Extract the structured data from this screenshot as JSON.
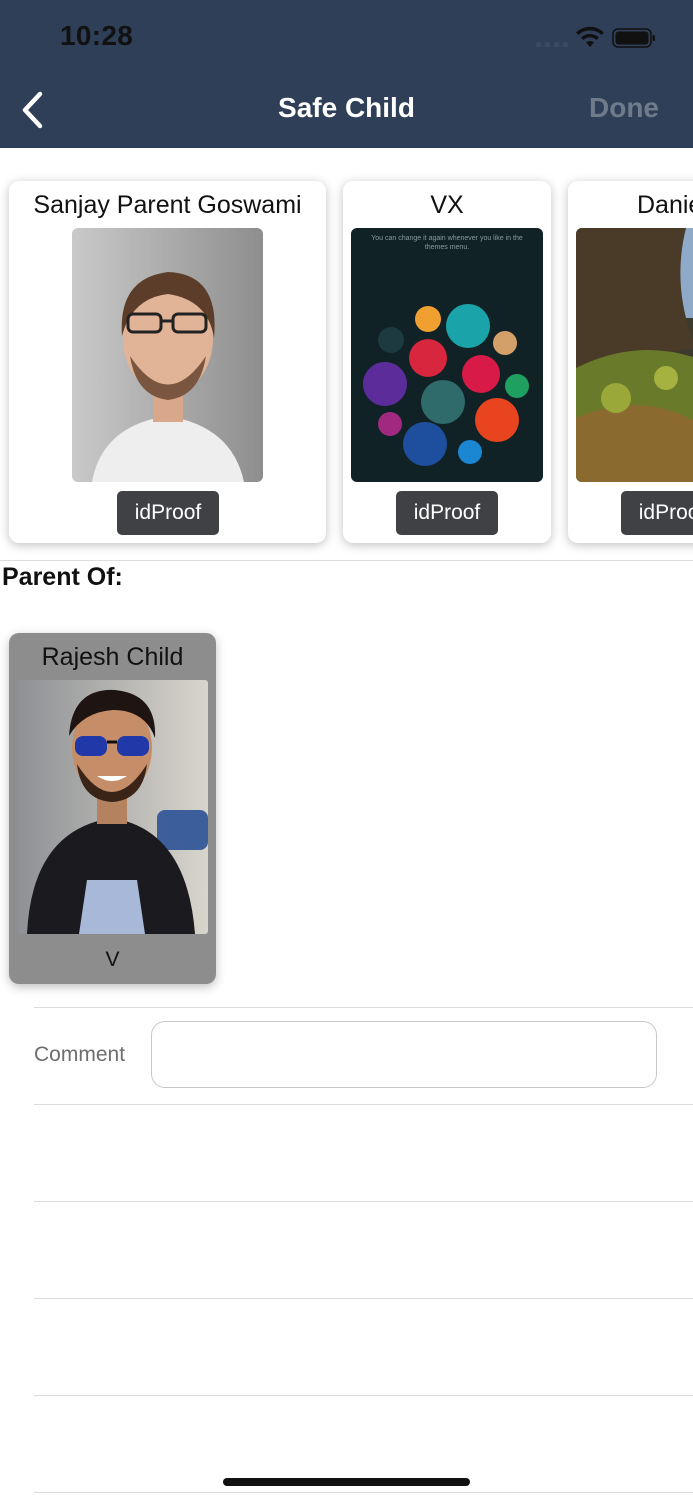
{
  "status_bar": {
    "time": "10:28"
  },
  "nav": {
    "title": "Safe Child",
    "done_label": "Done"
  },
  "cards": [
    {
      "name": "Sanjay Parent Goswami",
      "button_label": "idProof"
    },
    {
      "name": "VX",
      "button_label": "idProof",
      "photo_text": "You can change it again whenever you like in the themes menu."
    },
    {
      "name": "Daniel",
      "button_label": "idProof"
    }
  ],
  "section": {
    "parent_of_label": "Parent Of:"
  },
  "child": {
    "name": "Rajesh Child",
    "sub_label": "V"
  },
  "form": {
    "comment_label": "Comment",
    "comment_value": "",
    "comment_placeholder": ""
  },
  "colors": {
    "header_bg": "#2f3f58",
    "button_bg": "#3f4145",
    "child_card_bg": "#8d8d8d"
  }
}
